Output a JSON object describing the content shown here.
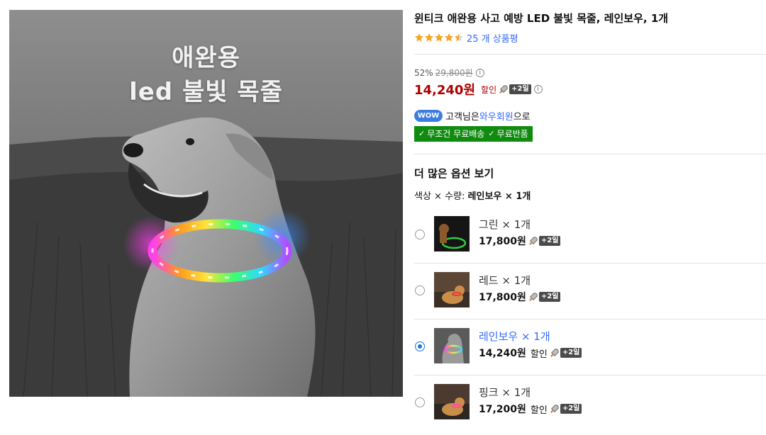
{
  "photo": {
    "caption_line1": "애완용",
    "caption_line2": "led 불빛 목줄"
  },
  "product": {
    "title": "윈티크 애완용 사고 예방 LED 불빛 목줄, 레인보우, 1개",
    "rating_stars": 4.5,
    "review_text": "25 개 상품평",
    "discount_rate": "52%",
    "original_price": "29,800원",
    "price": "14,240원",
    "sale_label": "할인",
    "rocket_badge": "+2일"
  },
  "wow": {
    "badge": "WOW",
    "text_before": "고객님은",
    "member": "와우회원",
    "text_after": "으로"
  },
  "benefits": [
    "무조건 무료배송",
    "무료반품"
  ],
  "options": {
    "heading": "더 많은 옵션 보기",
    "summary_label": "색상 × 수량:",
    "summary_value": "레인보우 × 1개",
    "items": [
      {
        "name": "그린 × 1개",
        "price": "17,800원",
        "sale": "",
        "badge": "+2일",
        "selected": false,
        "color": "#2ecc40"
      },
      {
        "name": "레드 × 1개",
        "price": "17,800원",
        "sale": "",
        "badge": "+2일",
        "selected": false,
        "color": "#e53935"
      },
      {
        "name": "레인보우 × 1개",
        "price": "14,240원",
        "sale": "할인",
        "badge": "+2일",
        "selected": true,
        "color": "#ff9800"
      },
      {
        "name": "핑크 × 1개",
        "price": "17,200원",
        "sale": "할인",
        "badge": "+2일",
        "selected": false,
        "color": "#ff4fa0"
      }
    ]
  },
  "colors": {
    "price_red": "#ae0000",
    "link_blue": "#346aff",
    "wow_blue": "#3d7de2",
    "benefit_green": "#0f8b0f",
    "star_orange": "#f5a623"
  }
}
